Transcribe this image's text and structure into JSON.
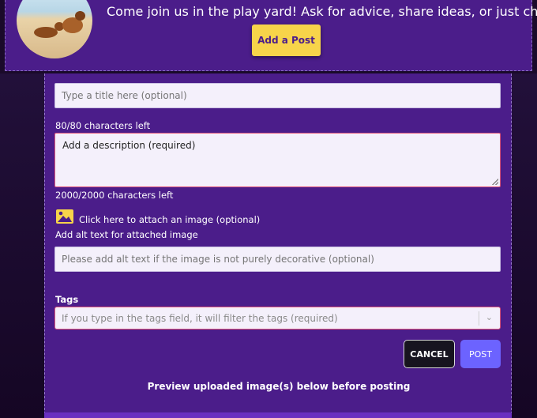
{
  "header": {
    "welcome_text": "Come join us in the play yard! Ask for advice, share ideas, or just chat!",
    "add_post_label": "Add a Post"
  },
  "form": {
    "title_placeholder": "Type a title here (optional)",
    "title_chars_left": "80/80 characters left",
    "description_placeholder": "Add a description (required)",
    "description_chars_left": "2000/2000 characters left",
    "attach_image_label": "Click here to attach an image (optional)",
    "alt_text_label": "Add alt text for attached image",
    "alt_text_placeholder": "Please add alt text if the image is not purely decorative (optional)",
    "tags_label": "Tags",
    "tags_placeholder": "If you type in the tags field, it will filter the tags (required)",
    "cancel_label": "CANCEL",
    "post_label": "POST",
    "preview_text": "Preview uploaded image(s) below before posting"
  },
  "icons": {
    "attach": "image-icon",
    "tags_dropdown": "chevron-down-icon"
  },
  "colors": {
    "accent_yellow": "#f7d44a",
    "header_purple": "#4b1d8a",
    "post_button": "#6c63ff",
    "required_border": "#e0557a"
  }
}
